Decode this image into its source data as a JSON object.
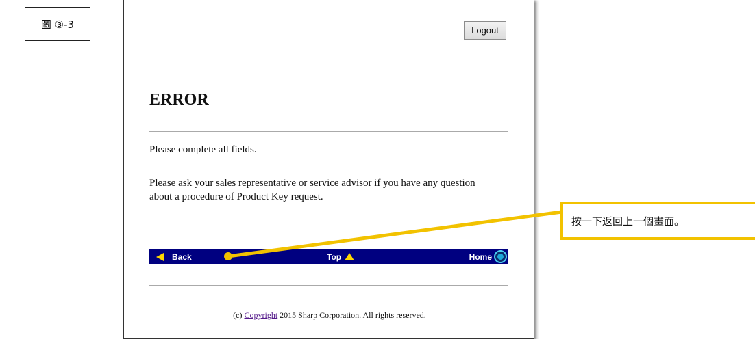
{
  "figure_label": "圖 ③-3",
  "page": {
    "logout_label": "Logout",
    "title": "ERROR",
    "message_1": "Please complete all fields.",
    "message_2": "Please ask your sales representative or service advisor if you have any question about a procedure of Product Key request.",
    "nav": {
      "back_label": "Back",
      "top_label": "Top",
      "home_label": "Home"
    },
    "footer": {
      "prefix": "(c) ",
      "link_text": "Copyright",
      "suffix": " 2015 Sharp Corporation. All rights reserved."
    }
  },
  "callout": {
    "text": "按一下返回上一個畫面。",
    "color": "#f2c200"
  },
  "colors": {
    "nav_bar": "#000080",
    "nav_arrow": "#ffd700"
  },
  "icons": [
    "back-arrow-icon",
    "top-arrow-icon",
    "home-icon"
  ]
}
